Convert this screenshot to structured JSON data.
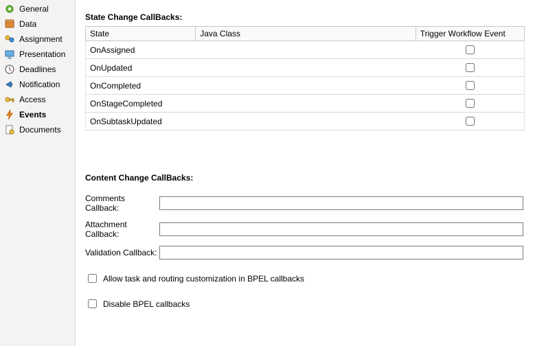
{
  "sidebar": {
    "items": [
      {
        "label": "General",
        "selected": false,
        "icon": "gear-icon"
      },
      {
        "label": "Data",
        "selected": false,
        "icon": "data-icon"
      },
      {
        "label": "Assignment",
        "selected": false,
        "icon": "assignment-icon"
      },
      {
        "label": "Presentation",
        "selected": false,
        "icon": "presentation-icon"
      },
      {
        "label": "Deadlines",
        "selected": false,
        "icon": "clock-icon"
      },
      {
        "label": "Notification",
        "selected": false,
        "icon": "bell-icon"
      },
      {
        "label": "Access",
        "selected": false,
        "icon": "key-icon"
      },
      {
        "label": "Events",
        "selected": true,
        "icon": "lightning-icon"
      },
      {
        "label": "Documents",
        "selected": false,
        "icon": "document-icon"
      }
    ]
  },
  "stateChange": {
    "title": "State Change CallBacks:",
    "columns": [
      "State",
      "Java Class",
      "Trigger Workflow Event"
    ],
    "rows": [
      {
        "state": "OnAssigned",
        "java": "",
        "trigger": false
      },
      {
        "state": "OnUpdated",
        "java": "",
        "trigger": false
      },
      {
        "state": "OnCompleted",
        "java": "",
        "trigger": false
      },
      {
        "state": "OnStageCompleted",
        "java": "",
        "trigger": false
      },
      {
        "state": "OnSubtaskUpdated",
        "java": "",
        "trigger": false
      }
    ]
  },
  "contentChange": {
    "title": "Content Change CallBacks:",
    "fields": [
      {
        "label": "Comments Callback:",
        "value": ""
      },
      {
        "label": "Attachment Callback:",
        "value": ""
      },
      {
        "label": "Validation Callback:",
        "value": ""
      }
    ]
  },
  "options": {
    "allow": {
      "label": "Allow task and routing customization in BPEL callbacks",
      "checked": false
    },
    "disable": {
      "label": "Disable BPEL callbacks",
      "checked": false
    }
  }
}
